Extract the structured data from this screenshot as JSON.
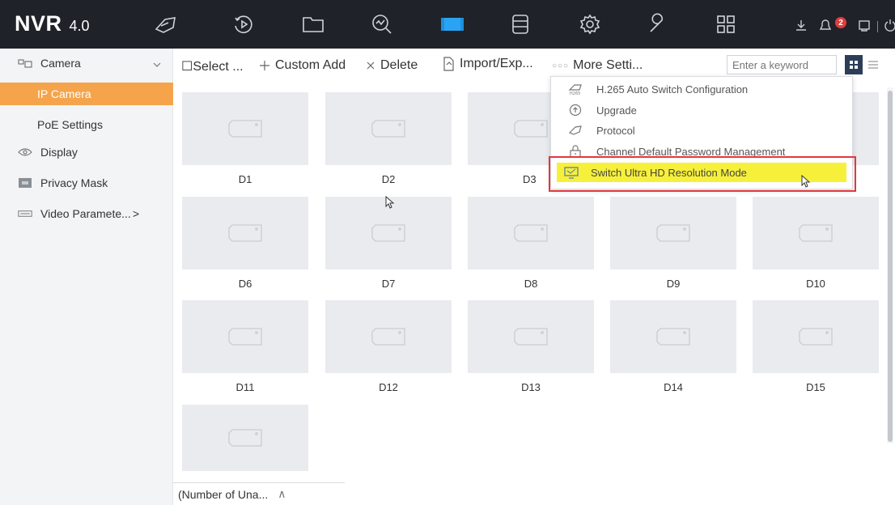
{
  "app": {
    "logo_main": "NVR",
    "logo_version": "4.0"
  },
  "topbar": {
    "nav_icons": [
      "live-view-icon",
      "playback-icon",
      "file-icon",
      "smart-analysis-icon",
      "camera-config-icon",
      "storage-icon",
      "system-settings-icon",
      "maintenance-icon",
      "layout-icon"
    ],
    "active_nav": "camera-config-icon",
    "alarm_count": "2",
    "colors": {
      "background": "#1f2228",
      "active": "#1e8fe0",
      "badge": "#e23b3b"
    }
  },
  "sidebar": {
    "group_label": "Camera",
    "active_item": "IP Camera",
    "sub_item_poe": "PoE Settings",
    "display_label": "Display",
    "privacy_label": "Privacy Mask",
    "video_param_label": "Video Paramete...",
    "active_color": "#f5a44c"
  },
  "toolbar": {
    "select_label": "☐Select ...",
    "custom_add_label": "Custom Add",
    "delete_label": "Delete",
    "import_label": "Import/Exp...",
    "more_settings_label": "More Setti...",
    "search_placeholder": "Enter a keyword"
  },
  "cameras": [
    "D1",
    "D2",
    "D3",
    "D6",
    "D7",
    "D8",
    "D9",
    "D10",
    "D11",
    "D12",
    "D13",
    "D14",
    "D15"
  ],
  "bottom_tab": {
    "label": "(Number of Una...",
    "toggle": "∧"
  },
  "more_settings_menu": {
    "items": [
      "H.265 Auto Switch Configuration",
      "Upgrade",
      "Protocol",
      "Channel Default Password Management",
      "Switch Ultra HD Resolution Mode"
    ],
    "highlighted_item": "Switch Ultra HD Resolution Mode",
    "highlight_color": "#f7f03b",
    "annotation_color": "#e0393c"
  }
}
